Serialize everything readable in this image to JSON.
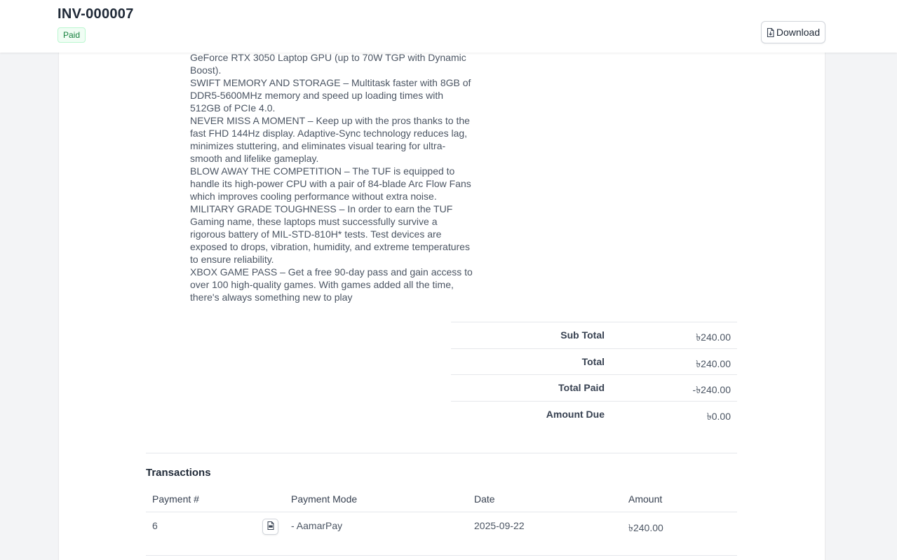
{
  "header": {
    "invoice_number": "INV-000007",
    "status": "Paid",
    "download_label": "Download"
  },
  "description_lines": [
    "GeForce RTX 3050 Laptop GPU (up to 70W TGP with Dynamic",
    "Boost).",
    "SWIFT MEMORY AND STORAGE – Multitask faster with 8GB of",
    "DDR5-5600MHz memory and speed up loading times with",
    "512GB of PCIe 4.0.",
    "NEVER MISS A MOMENT – Keep up with the pros thanks to the",
    "fast FHD 144Hz display. Adaptive-Sync technology reduces lag,",
    "minimizes stuttering, and eliminates visual tearing for ultra-",
    "smooth and lifelike gameplay.",
    "BLOW AWAY THE COMPETITION – The TUF is equipped to",
    "handle its high-power CPU with a pair of 84-blade Arc Flow Fans",
    "which improves cooling performance without extra noise.",
    "MILITARY GRADE TOUGHNESS – In order to earn the TUF",
    "Gaming name, these laptops must successfully survive a",
    "rigorous battery of MIL-STD-810H* tests. Test devices are",
    "exposed to drops, vibration, humidity, and extreme temperatures",
    "to ensure reliability.",
    "XBOX GAME PASS – Get a free 90-day pass and gain access to",
    "over 100 high-quality games. With games added all the time,",
    "there's always something new to play"
  ],
  "totals": {
    "sub_total_label": "Sub Total",
    "sub_total_value": "৳240.00",
    "total_label": "Total",
    "total_value": "৳240.00",
    "total_paid_label": "Total Paid",
    "total_paid_value": "-৳240.00",
    "amount_due_label": "Amount Due",
    "amount_due_value": "৳0.00"
  },
  "transactions": {
    "title": "Transactions",
    "columns": {
      "payment_no": "Payment #",
      "payment_mode": "Payment Mode",
      "date": "Date",
      "amount": "Amount"
    },
    "rows": [
      {
        "payment_no": "6",
        "payment_mode": "- AamarPay",
        "date": "2025-09-22",
        "amount": "৳240.00"
      }
    ]
  },
  "colors": {
    "paid_badge_text": "#15803d",
    "paid_badge_bg": "#f0fdf4",
    "page_bg": "#f3f4f6"
  },
  "icons": {
    "download": "file-download-icon",
    "receipt": "pdf-file-icon"
  }
}
